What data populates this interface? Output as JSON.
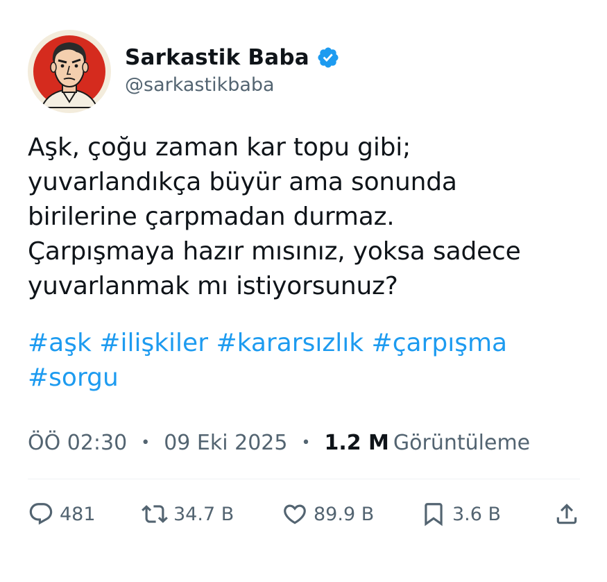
{
  "author": {
    "display_name": "Sarkastik Baba",
    "handle": "@sarkastikbaba",
    "verified": true,
    "avatar_icon": "cartoon-man-portrait-avatar",
    "avatar_bg": "#d52b1e"
  },
  "tweet": {
    "text": "Aşk, çoğu zaman kar topu gibi;\nyuvarlandıkça büyür ama sonunda\nbirilerine çarpmadan durmaz.\nÇarpışmaya hazır mısınız, yoksa sadece\nyuvarlanmak mı istiyorsunuz?",
    "hashtags": [
      "#aşk",
      "#ilişkiler",
      "#kararsızlık",
      "#çarpışma",
      "#sorgu"
    ]
  },
  "meta": {
    "time": "ÖÖ 02:30",
    "separator": "•",
    "date": "09 Eki 2025",
    "views_count": "1.2 M",
    "views_label": "Görüntüleme"
  },
  "actions": {
    "replies": "481",
    "retweets": "34.7 B",
    "likes": "89.9 B",
    "bookmarks": "3.6 B"
  },
  "colors": {
    "accent": "#1d9bf0",
    "secondary_text": "#536471",
    "primary_text": "#0f1419"
  }
}
